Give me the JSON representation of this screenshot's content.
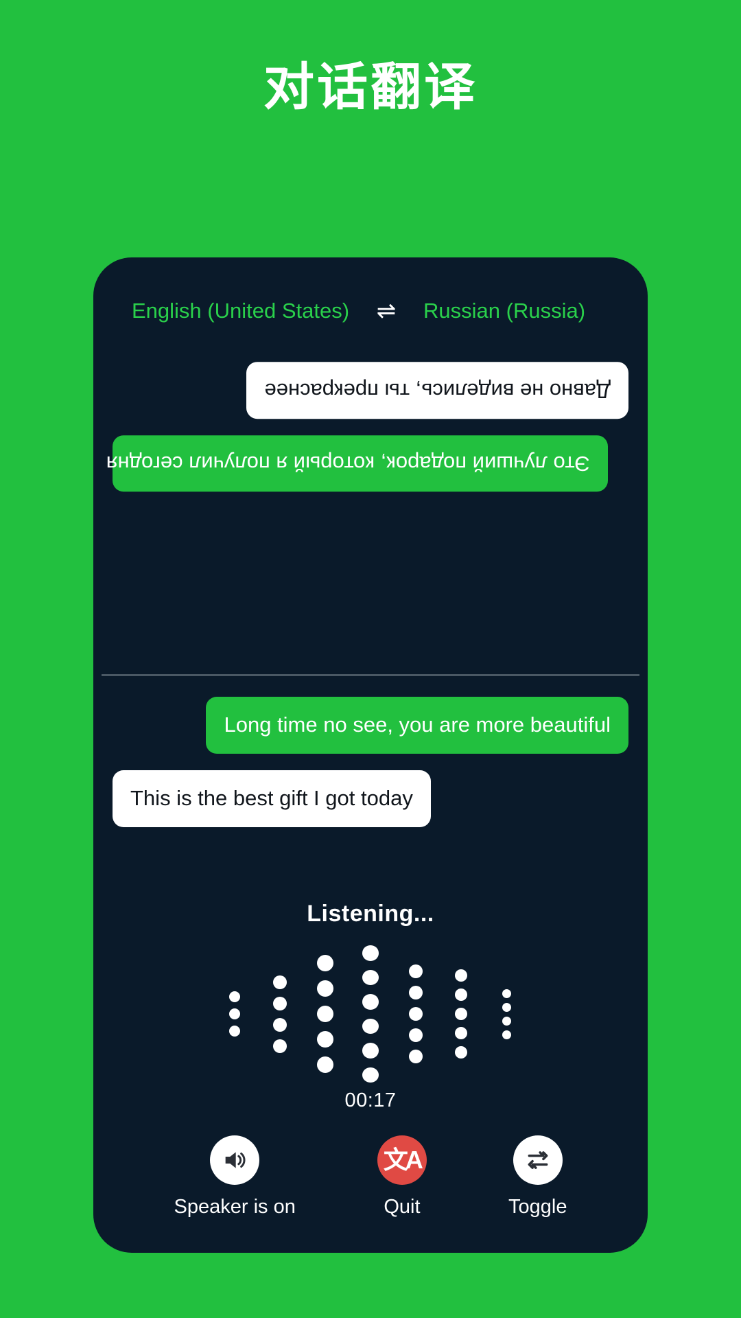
{
  "page": {
    "title": "对话翻译",
    "background_color": "#22c03f",
    "card_color": "#0a1a2a",
    "accent_green": "#22c03f",
    "accent_red": "#e04a44",
    "lang_text_color": "#2ad14b"
  },
  "language_bar": {
    "source_language": "English (United States)",
    "swap_icon": "swap-horizontal-icon",
    "swap_glyph": "⇌",
    "target_language": "Russian (Russia)"
  },
  "conversation": {
    "top_panel_rotated": true,
    "top_messages": [
      {
        "text": "Это лучший подарок, который я получил сегодня",
        "style": "green",
        "align": "left"
      },
      {
        "text": "Давно не виделись, ты прекраснее",
        "style": "white",
        "align": "right"
      }
    ],
    "bottom_messages": [
      {
        "text": "Long time no see, you are more beautiful",
        "style": "green",
        "align": "right"
      },
      {
        "text": "This is the best gift I got today",
        "style": "white",
        "align": "left"
      }
    ]
  },
  "recorder": {
    "status_label": "Listening...",
    "timer": "00:17",
    "waveform_columns": [
      {
        "count": 3,
        "dot_size": 16
      },
      {
        "count": 4,
        "dot_size": 20
      },
      {
        "count": 5,
        "dot_size": 24
      },
      {
        "count": 6,
        "dot_size": 24
      },
      {
        "count": 5,
        "dot_size": 20
      },
      {
        "count": 5,
        "dot_size": 18
      },
      {
        "count": 4,
        "dot_size": 13
      }
    ]
  },
  "actions": [
    {
      "label": "Speaker is on",
      "icon": "speaker-on-icon",
      "circle_style": "white"
    },
    {
      "label": "Quit",
      "icon": "translate-icon",
      "glyph": "文A",
      "circle_style": "red"
    },
    {
      "label": "Toggle",
      "icon": "swap-repeat-icon",
      "circle_style": "white"
    }
  ]
}
